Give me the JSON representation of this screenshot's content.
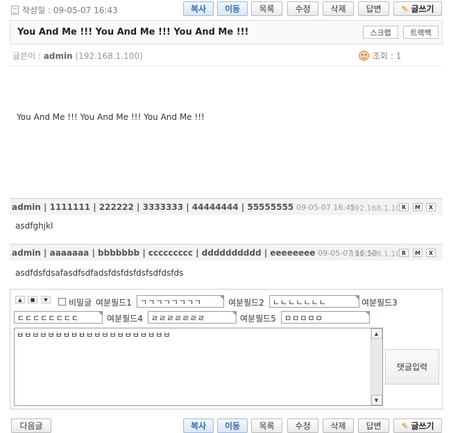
{
  "post": {
    "date_label": "작성일 : 09-05-07 16:43",
    "title": "You And Me !!! You And Me !!! You And Me !!!",
    "writer_label": "글쓴이 :",
    "writer": "admin",
    "writer_ip": "(192.168.1.100)",
    "views": "조회 : 1",
    "body": "You And Me !!! You And Me !!! You And Me !!!"
  },
  "toolbar": {
    "copy": "복사",
    "move": "이동",
    "list": "목록",
    "edit": "수정",
    "delete": "삭제",
    "reply": "답변",
    "write": "글쓰기",
    "next": "다음글"
  },
  "title_buttons": {
    "scrap": "스크랩",
    "trackback": "트랙백"
  },
  "comments": [
    {
      "author": "admin",
      "fields": " | 1111111 | 222222 | 3333333 | 44444444 | 55555555",
      "date": "09-05-07 16:45",
      "ip": "192.168.1.100",
      "text": "asdfghjkl"
    },
    {
      "author": "admin",
      "fields": " | aaaaaaa | bbbbbbb | ccccccccc | dddddddddd | eeeeeeee",
      "date": "09-05-07 16:50",
      "ip": "192.168.1.100",
      "text": "asdfdsfdsafasdfsdfadsfdsfdsfdsfsdfdsfds"
    }
  ],
  "comment_buttons": {
    "reply": "R",
    "modify": "M",
    "delete": "X"
  },
  "comment_form": {
    "secret_label": "비밀글",
    "field1_label": "여분필드1",
    "field1_value": "ㄱㄱㄱㄱㄱㄱㄱㄱ",
    "field2_label": "여분필드2",
    "field2_value": "ㄴㄴㄴㄴㄴㄴㄴ",
    "field3_label": "여분필드3",
    "field3_value": "ㄷㄷㄷㄷㄷㄷㄷㄷ",
    "field4_label": "여분필드4",
    "field4_value": "ㄹㄹㄹㄹㄹㄹㄹ",
    "field5_label": "여분필드5",
    "field5_value": "ㅁㅁㅁㅁㅁ",
    "content": "ㅂㅂㅂㅂㅂㅂㅂㅂㅂㅂㅂㅂㅂㅂㅂㅂㅂㅂㅂㅂ",
    "submit": "댓글입력"
  },
  "icons": {
    "doc": "document-icon",
    "views": "smiley-face-icon",
    "write": "pencil-icon"
  },
  "colors": {
    "accent_button_text": "#3a6aa8",
    "comment_header_bg": "#f3f3f3"
  }
}
